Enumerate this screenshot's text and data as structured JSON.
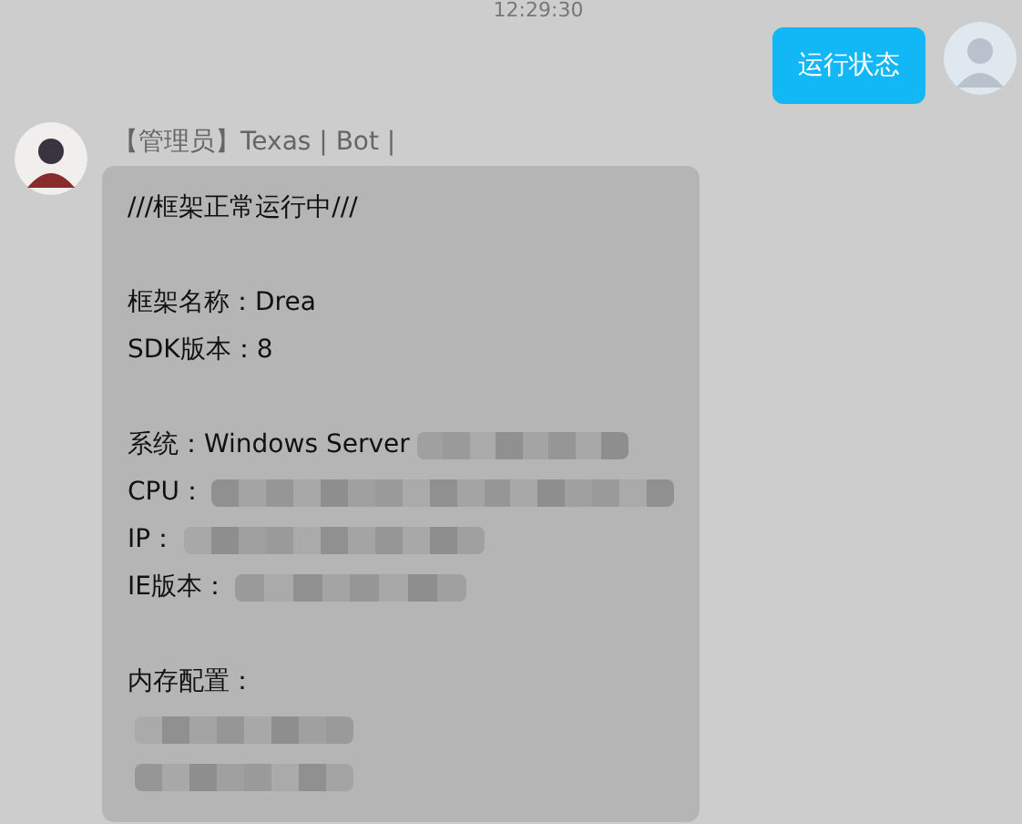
{
  "timestamp": "12:29:30",
  "outgoing": {
    "text": "运行状态"
  },
  "incoming": {
    "sender": "【管理员】Texas | Bot |",
    "lines": [
      {
        "kind": "text",
        "label": "///框架正常运行中///"
      },
      {
        "kind": "blank"
      },
      {
        "kind": "text",
        "label": "框架名称：Drea"
      },
      {
        "kind": "text",
        "label": "SDK版本：8"
      },
      {
        "kind": "blank"
      },
      {
        "kind": "redacted",
        "label": "系统：Windows Server "
      },
      {
        "kind": "redacted",
        "label": "CPU："
      },
      {
        "kind": "redacted",
        "label": "IP："
      },
      {
        "kind": "redacted",
        "label": "IE版本："
      },
      {
        "kind": "blank"
      },
      {
        "kind": "text",
        "label": "内存配置："
      },
      {
        "kind": "redacted"
      },
      {
        "kind": "redacted"
      }
    ]
  }
}
